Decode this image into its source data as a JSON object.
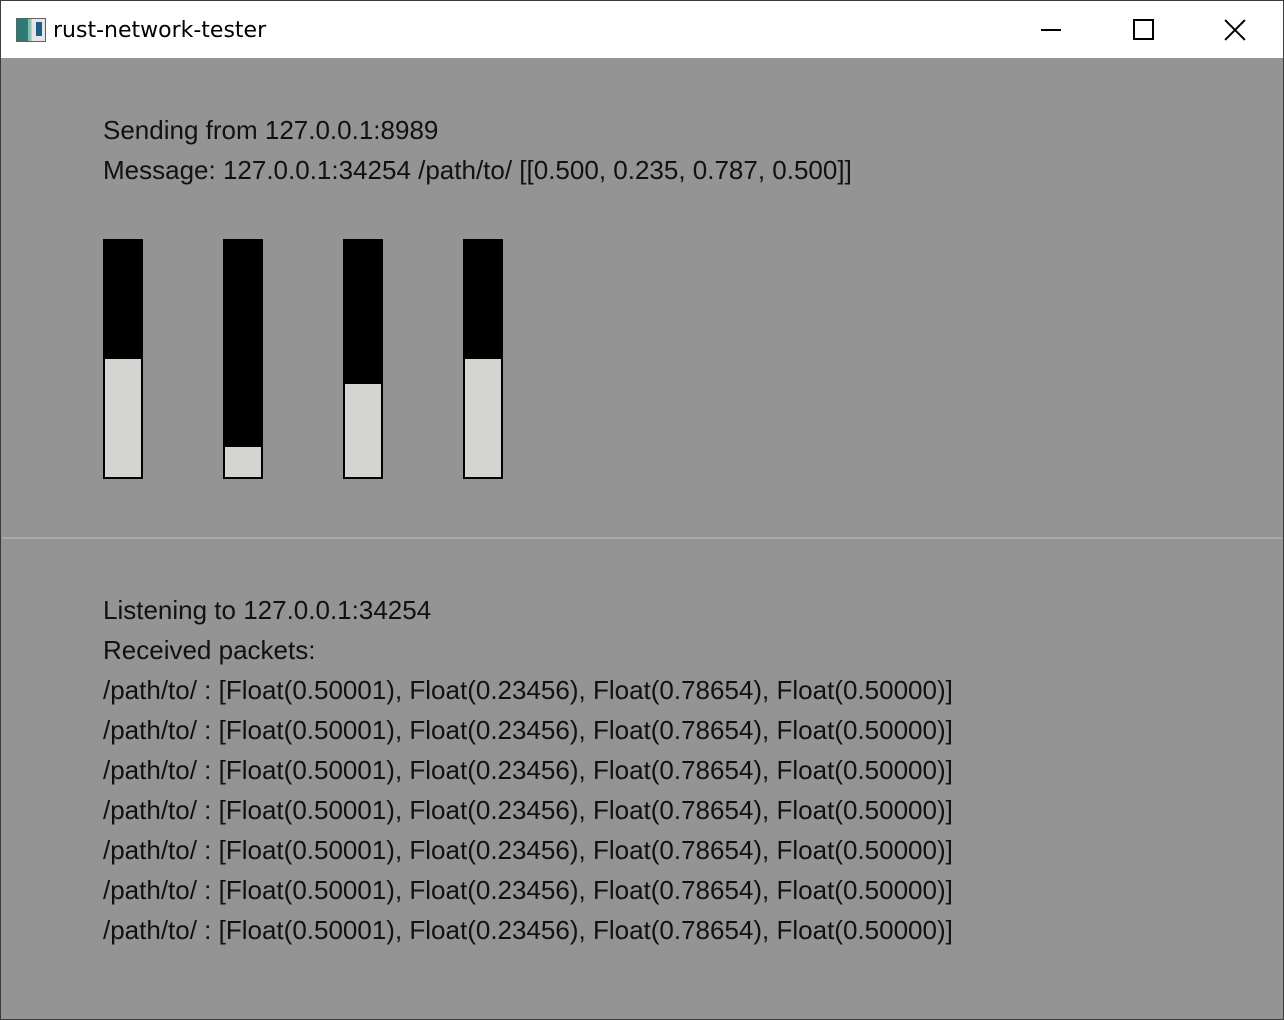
{
  "window": {
    "title": "rust-network-tester",
    "controls": {
      "minimize": "minimize-icon",
      "maximize": "maximize-icon",
      "close": "close-icon"
    }
  },
  "sender": {
    "sending_from": "Sending from 127.0.0.1:8989",
    "message": "Message: 127.0.0.1:34254 /path/to/ [[0.500, 0.235, 0.787, 0.500]]",
    "sliders": [
      {
        "value": 0.5
      },
      {
        "value": 0.125
      },
      {
        "value": 0.396
      },
      {
        "value": 0.5
      }
    ]
  },
  "receiver": {
    "listening": "Listening to 127.0.0.1:34254",
    "received_label": "Received packets:",
    "packets": [
      "/path/to/ : [Float(0.50001), Float(0.23456), Float(0.78654), Float(0.50000)]",
      "/path/to/ : [Float(0.50001), Float(0.23456), Float(0.78654), Float(0.50000)]",
      "/path/to/ : [Float(0.50001), Float(0.23456), Float(0.78654), Float(0.50000)]",
      "/path/to/ : [Float(0.50001), Float(0.23456), Float(0.78654), Float(0.50000)]",
      "/path/to/ : [Float(0.50001), Float(0.23456), Float(0.78654), Float(0.50000)]",
      "/path/to/ : [Float(0.50001), Float(0.23456), Float(0.78654), Float(0.50000)]",
      "/path/to/ : [Float(0.50001), Float(0.23456), Float(0.78654), Float(0.50000)]"
    ]
  }
}
